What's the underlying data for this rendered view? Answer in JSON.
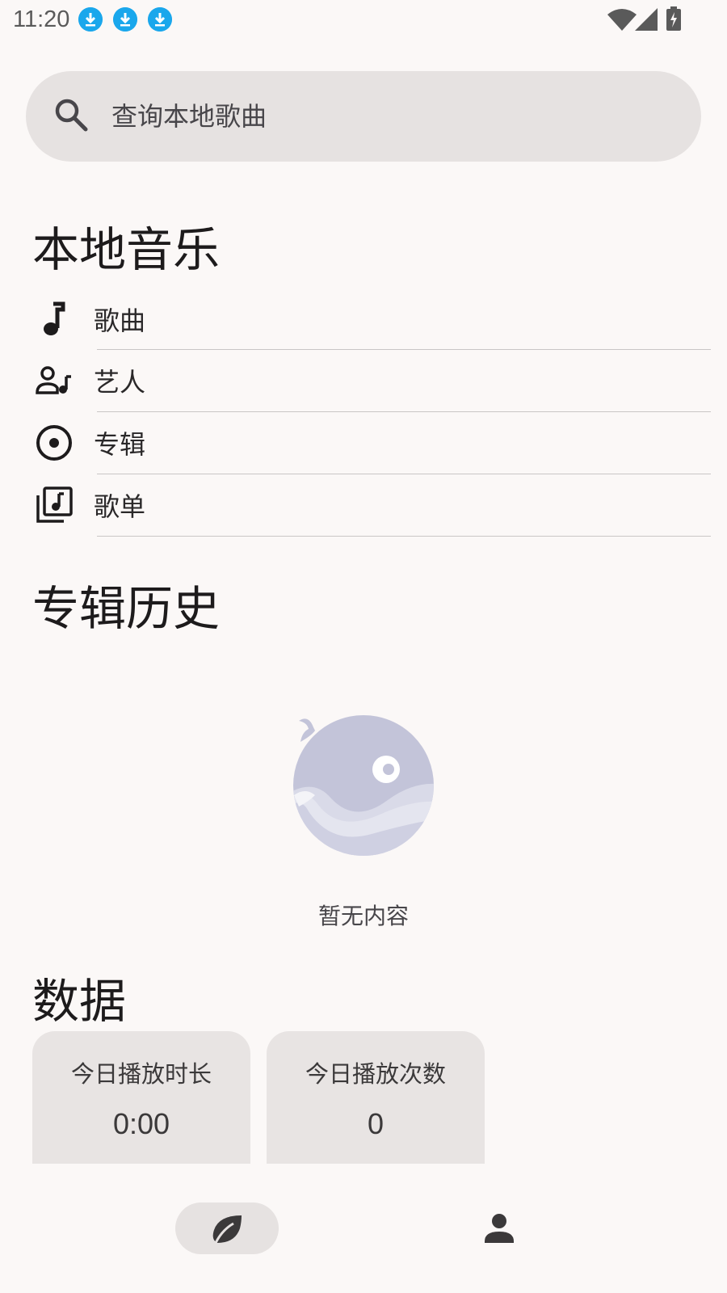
{
  "status_bar": {
    "time": "11:20",
    "notification_icons": [
      "download-icon",
      "download-icon",
      "download-icon"
    ]
  },
  "search": {
    "placeholder": "查询本地歌曲"
  },
  "local_music": {
    "title": "本地音乐",
    "items": [
      {
        "label": "歌曲",
        "icon": "music-note-icon"
      },
      {
        "label": "艺人",
        "icon": "artist-icon"
      },
      {
        "label": "专辑",
        "icon": "album-icon"
      },
      {
        "label": "歌单",
        "icon": "playlist-icon"
      }
    ]
  },
  "album_history": {
    "title": "专辑历史",
    "empty_text": "暂无内容"
  },
  "stats": {
    "title": "数据",
    "cards": [
      {
        "label": "今日播放时长",
        "value": "0:00"
      },
      {
        "label": "今日播放次数",
        "value": "0"
      }
    ]
  },
  "bottom_nav": {
    "items": [
      {
        "icon": "leaf-icon",
        "selected": true
      },
      {
        "icon": "person-icon",
        "selected": false
      }
    ]
  },
  "colors": {
    "background": "#fbf8f7",
    "surface": "#e6e2e1",
    "notification_accent": "#1aa7ec",
    "whale": "#c3c4d9"
  }
}
